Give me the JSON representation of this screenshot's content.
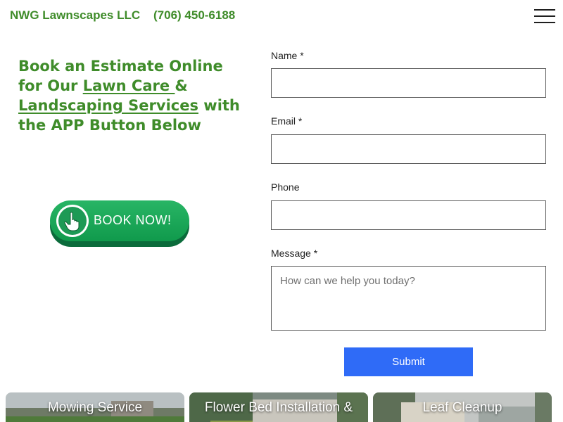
{
  "header": {
    "brand": "NWG Lawnscapes LLC",
    "phone": "(706) 450-6188",
    "menu_icon": "hamburger-menu-icon"
  },
  "hero": {
    "part1": "Book an Estimate Online for Our ",
    "link_lawn_care": "Lawn Care ",
    "part2": "& ",
    "link_landscaping": "Landscaping Services",
    "part3": " with the APP Button Below"
  },
  "book_button": {
    "label": "BOOK NOW!",
    "icon": "pointing-hand-icon"
  },
  "form": {
    "name_label": "Name *",
    "email_label": "Email *",
    "phone_label": "Phone",
    "message_label": "Message *",
    "message_placeholder": "How can we help you today?",
    "submit_label": "Submit"
  },
  "services": [
    {
      "title": "Mowing Service"
    },
    {
      "title": "Flower Bed Installation &"
    },
    {
      "title": "Leaf Cleanup"
    }
  ],
  "colors": {
    "brand_green": "#3f8c2a",
    "button_green": "#1a9e50",
    "submit_blue": "#2f6bf7"
  }
}
